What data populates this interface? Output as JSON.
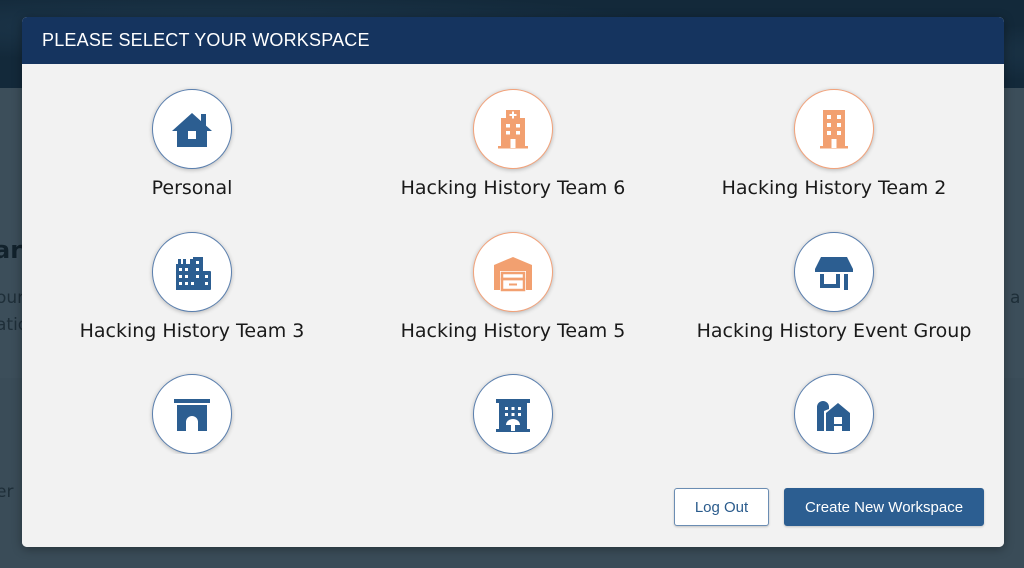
{
  "background": {
    "heading_fragment": "ar",
    "line1_fragment": "our",
    "line2_fragment": "atio",
    "line3_fragment": "er",
    "right_fragment": "a ti"
  },
  "modal": {
    "title": "PLEASE SELECT YOUR WORKSPACE",
    "workspaces": [
      {
        "label": "Personal",
        "icon": "house-icon",
        "color": "#2c5e91"
      },
      {
        "label": "Hacking History Team 6",
        "icon": "hospital-icon",
        "color": "#f2a070"
      },
      {
        "label": "Hacking History Team 2",
        "icon": "office-building-icon",
        "color": "#f2a070"
      },
      {
        "label": "Hacking History Team 3",
        "icon": "industry-buildings-icon",
        "color": "#2c5e91"
      },
      {
        "label": "Hacking History Team 5",
        "icon": "warehouse-garage-icon",
        "color": "#f2a070"
      },
      {
        "label": "Hacking History Event Group",
        "icon": "store-icon",
        "color": "#2c5e91"
      },
      {
        "label": "",
        "icon": "archway-icon",
        "color": "#2c5e91"
      },
      {
        "label": "",
        "icon": "hotel-icon",
        "color": "#2c5e91"
      },
      {
        "label": "",
        "icon": "barn-silo-icon",
        "color": "#2c5e91"
      }
    ],
    "buttons": {
      "logout": "Log Out",
      "create": "Create New Workspace"
    }
  }
}
